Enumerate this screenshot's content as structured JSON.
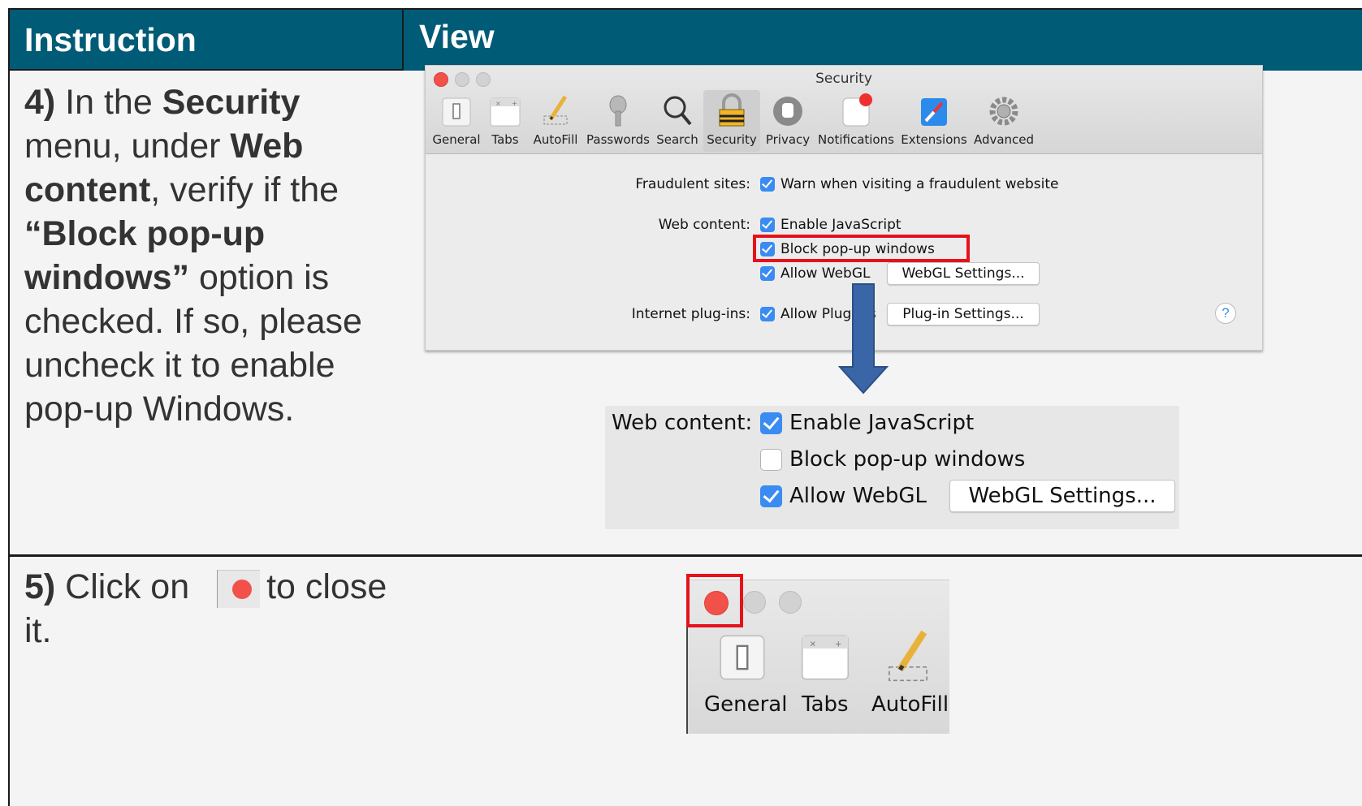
{
  "header": {
    "instruction": "Instruction",
    "view": "View"
  },
  "step4": {
    "num": "4)",
    "t1": " In the ",
    "b1": "Security",
    "t2": " menu, under ",
    "b2": "Web content",
    "t3": ", verify if the ",
    "b3": "“Block pop-up windows”",
    "t4": " option is checked. If so, please uncheck it to enable pop-up Windows."
  },
  "step5": {
    "num": "5)",
    "t1": " Click on ",
    "t2": "to close it."
  },
  "prefs": {
    "title": "Security",
    "tabs": [
      "General",
      "Tabs",
      "AutoFill",
      "Passwords",
      "Search",
      "Security",
      "Privacy",
      "Notifications",
      "Extensions",
      "Advanced"
    ],
    "selected_tab": "Security",
    "fraudulent_label": "Fraudulent sites:",
    "fraudulent_opt": "Warn when visiting a fraudulent website",
    "web_label": "Web content:",
    "enable_js": "Enable JavaScript",
    "block_popups": "Block pop-up windows",
    "allow_webgl": "Allow WebGL",
    "webgl_btn": "WebGL Settings...",
    "plugins_label": "Internet plug-ins:",
    "allow_plugins": "Allow Plug-ins",
    "plugin_btn": "Plug-in Settings...",
    "help": "?",
    "checked": {
      "fraudulent": true,
      "enable_js": true,
      "block_popups": true,
      "allow_webgl": true,
      "allow_plugins": true
    }
  },
  "zoom": {
    "web_label": "Web content:",
    "enable_js": "Enable JavaScript",
    "block_popups": "Block pop-up windows",
    "allow_webgl": "Allow WebGL",
    "webgl_btn": "WebGL Settings...",
    "checked": {
      "enable_js": true,
      "block_popups": false,
      "allow_webgl": true
    }
  },
  "crop": {
    "tabs": [
      "General",
      "Tabs",
      "AutoFill"
    ]
  },
  "colors": {
    "header_bg": "#005b76",
    "highlight": "#e5121b",
    "close_dot": "#f2514a",
    "checkbox": "#3a8bf2",
    "arrow": "#3a66a8"
  }
}
